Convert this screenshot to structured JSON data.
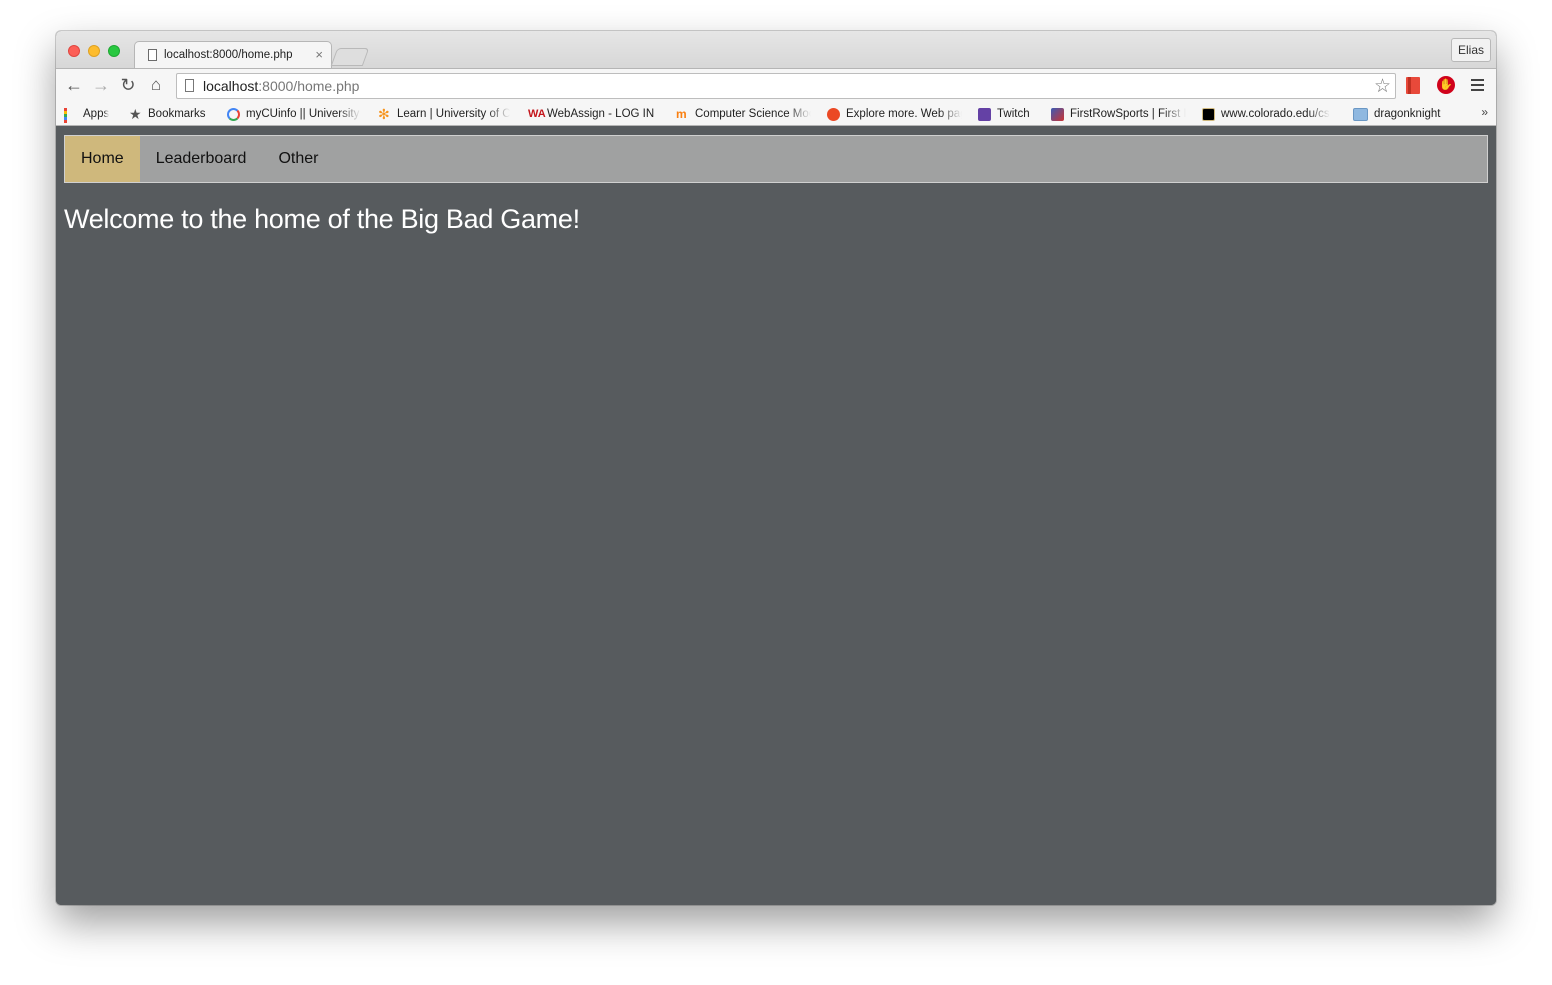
{
  "browser": {
    "tab": {
      "title": "localhost:8000/home.php",
      "close": "×"
    },
    "profile": "Elias",
    "omnibox": {
      "host": "localhost",
      "rest": ":8000/home.php"
    },
    "bookmarks": [
      {
        "label": "Apps",
        "icon": "apps-grid-icon"
      },
      {
        "label": "Bookmarks",
        "icon": "star-icon"
      },
      {
        "label": "myCUinfo || University of Colorado",
        "icon": "google-icon"
      },
      {
        "label": "Learn | University of Colorado",
        "icon": "learn-icon"
      },
      {
        "label": "WebAssign - LOG IN",
        "icon": "webassign-icon"
      },
      {
        "label": "Computer Science Moodle",
        "icon": "moodle-icon"
      },
      {
        "label": "Explore more. Web pages",
        "icon": "stumbleupon-icon"
      },
      {
        "label": "Twitch",
        "icon": "twitch-icon"
      },
      {
        "label": "FirstRowSports | First Row Sports",
        "icon": "firstrowsports-icon"
      },
      {
        "label": "www.colorado.edu/cs",
        "icon": "cu-icon"
      },
      {
        "label": "dragonknight",
        "icon": "folder-icon"
      }
    ],
    "more_bookmarks": "»"
  },
  "site": {
    "nav": [
      {
        "label": "Home",
        "active": true
      },
      {
        "label": "Leaderboard",
        "active": false
      },
      {
        "label": "Other",
        "active": false
      }
    ],
    "heading": "Welcome to the home of the Big Bad Game!"
  },
  "colors": {
    "page_background": "#575b5e",
    "nav_background": "#a0a1a1",
    "nav_active": "#cfb87c",
    "heading_text": "#ffffff"
  }
}
